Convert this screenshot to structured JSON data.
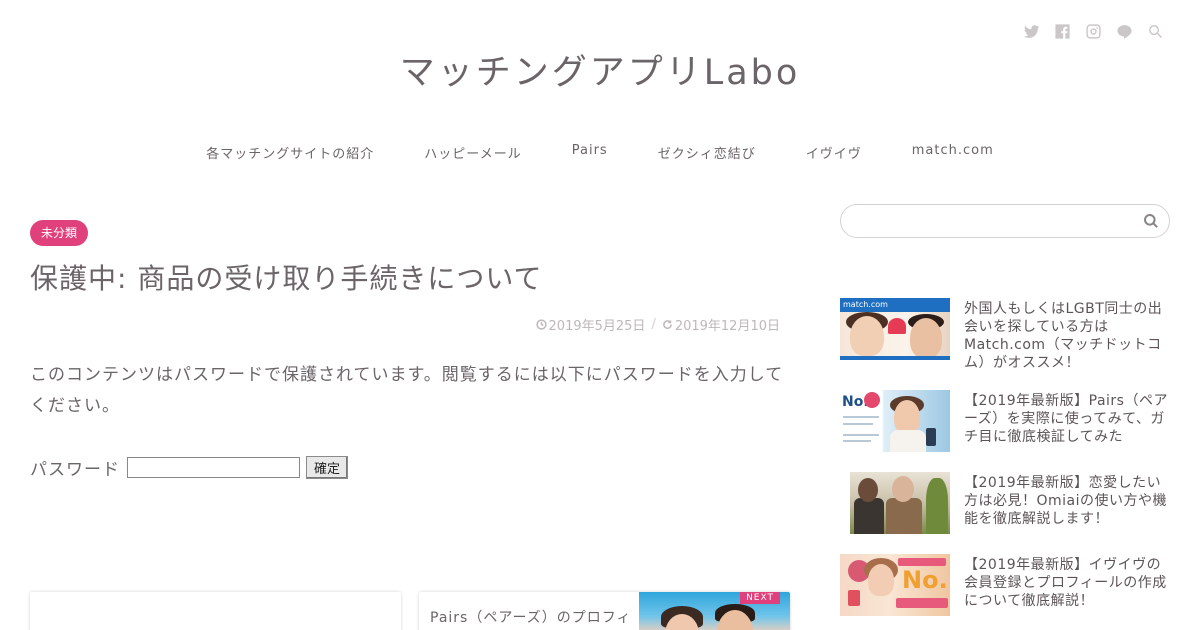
{
  "header": {
    "site_title": "マッチングアプリLabo",
    "social_icons": [
      "twitter-icon",
      "facebook-icon",
      "instagram-icon",
      "line-icon",
      "search-icon"
    ]
  },
  "nav": {
    "items": [
      {
        "label": "各マッチングサイトの紹介"
      },
      {
        "label": "ハッピーメール"
      },
      {
        "label": "Pairs"
      },
      {
        "label": "ゼクシィ恋結び"
      },
      {
        "label": "イヴイヴ"
      },
      {
        "label": "match.com"
      }
    ]
  },
  "article": {
    "category": "未分類",
    "title": "保護中: 商品の受け取り手続きについて",
    "published": "2019年5月25日",
    "separator": "/",
    "updated": "2019年12月10日",
    "protected_message": "このコンテンツはパスワードで保護されています。閲覧するには以下にパスワードを入力してください。",
    "password_label": "パスワード",
    "password_value": "",
    "submit_label": "確定"
  },
  "post_nav": {
    "next_badge": "NEXT",
    "next_title": "Pairs（ペアーズ）のプロフィ"
  },
  "sidebar": {
    "search_placeholder": "",
    "posts": [
      {
        "title": "外国人もしくはLGBT同士の出会いを探している方はMatch.com（マッチドットコム）がオススメ！",
        "thumb_caption": "match.com"
      },
      {
        "title": "【2019年最新版】Pairs（ペアーズ）を実際に使ってみて、ガチ目に徹底検証してみた",
        "thumb_caption": "No.1"
      },
      {
        "title": "【2019年最新版】恋愛したい方は必見！Omiaiの使い方や機能を徹底解説します！",
        "thumb_caption": ""
      },
      {
        "title": "【2019年最新版】イヴイヴの会員登録とプロフィールの作成について徹底解説！",
        "thumb_caption": "No.1"
      }
    ]
  },
  "colors": {
    "accent": "#e0407b",
    "text": "#6b6468",
    "muted": "#bdb7ba"
  }
}
